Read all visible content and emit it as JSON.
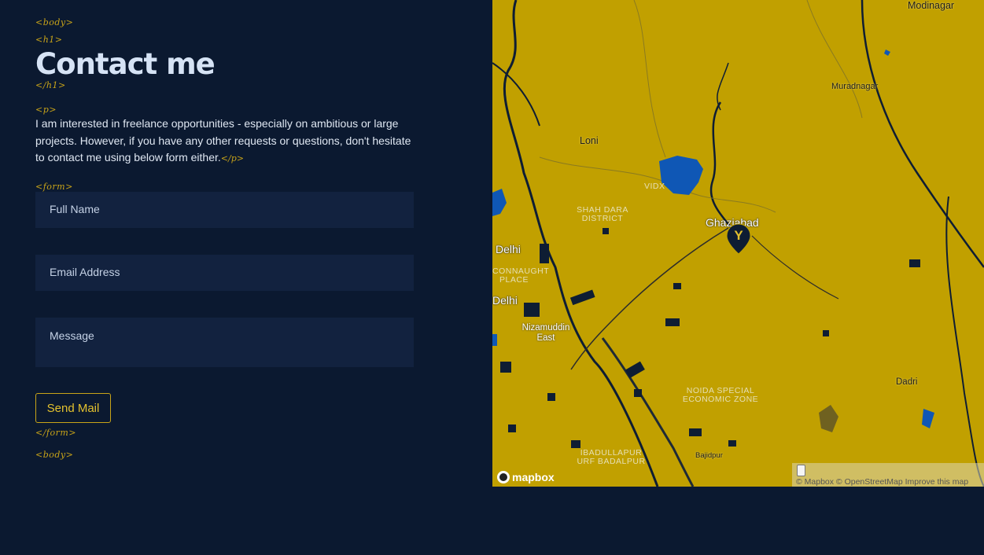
{
  "tags": {
    "body_open": "<body>",
    "h1_open": "<h1>",
    "h1_close": "</h1>",
    "p_open": "<p>",
    "p_close": "</p>",
    "form_open": "<form>",
    "form_close": "</form>",
    "body_close": "<body>"
  },
  "heading": "Contact me",
  "intro": "I am interested in freelance opportunities - especially on ambitious or large projects. However, if you have any other requests or questions, don't hesitate to contact me using below form either.",
  "form": {
    "name_placeholder": "Full Name",
    "email_placeholder": "Email Address",
    "message_placeholder": "Message",
    "submit_label": "Send Mail"
  },
  "map": {
    "labels": {
      "modinagar": "Modinagar",
      "muradnagar": "Muradnagar",
      "loni": "Loni",
      "vidx": "VIDX",
      "shahdara": "SHAH DARA DISTRICT",
      "ghaziabad": "Ghaziabad",
      "delhi1": "Delhi",
      "connaught": "CONNAUGHT PLACE",
      "delhi2": "Delhi",
      "nizamuddin": "Nizamuddin East",
      "noida": "NOIDA SPECIAL ECONOMIC ZONE",
      "dadri": "Dadri",
      "badalpur": "BADALPUR",
      "bajidpur": "Bajidpur",
      "ibadullapur": "IBADULLAPUR URF BADALPUR"
    },
    "marker_letter": "Y",
    "logo_text": "mapbox",
    "attribution": "© Mapbox © OpenStreetMap Improve this map",
    "colors": {
      "land": "#c1a000",
      "water": "#0f57b5",
      "dark": "#0e1d33"
    }
  }
}
